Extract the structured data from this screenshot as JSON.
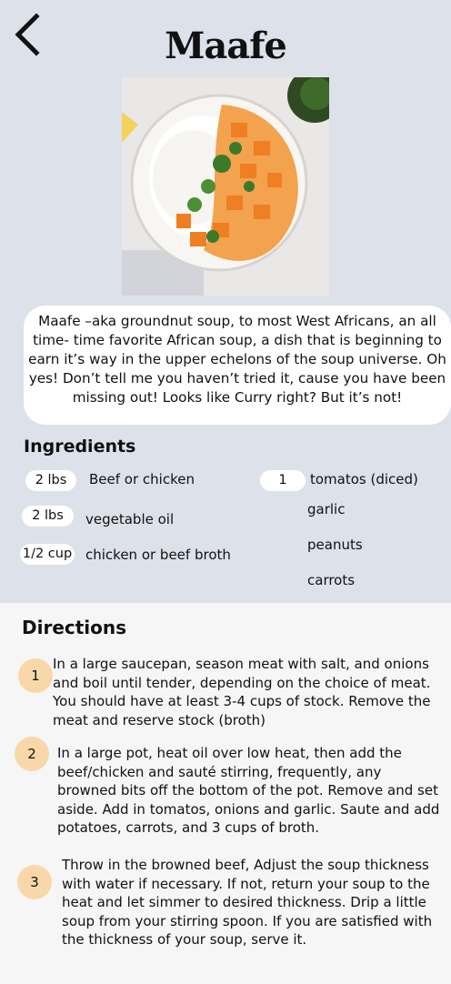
{
  "header": {
    "title": "Maafe"
  },
  "description": "Maafe –aka groundnut soup, to most West Africans, an all time- time favorite African soup, a dish that is beginning to earn it’s way in the upper echelons of the soup universe. Oh yes! Don’t tell me you haven’t tried it, cause you have been missing out! Looks like Curry right? But it’s not!",
  "ingredients": {
    "title": "Ingredients",
    "left": [
      {
        "qty": "2 lbs",
        "name": "Beef or chicken"
      },
      {
        "qty": "2 lbs",
        "name": "vegetable oil"
      },
      {
        "qty": "1/2 cup",
        "name": "chicken or beef broth"
      }
    ],
    "right": [
      {
        "qty": "1",
        "name": "tomatos (diced)"
      },
      {
        "name": "garlic"
      },
      {
        "name": "peanuts"
      },
      {
        "name": "carrots"
      }
    ]
  },
  "directions": {
    "title": "Directions",
    "steps": [
      {
        "num": "1",
        "text": "In a large saucepan, season meat with salt, and onions and boil until tender, depending on the choice of meat. You should have at least 3-4 cups of stock. Remove the meat and reserve stock (broth)"
      },
      {
        "num": "2",
        "text": "In a large pot, heat oil over low heat, then add the beef/chicken and sauté stirring, frequently, any browned bits off the bottom of the pot. Remove and set aside. Add in tomatos, onions and garlic. Saute and add potatoes, carrots, and 3 cups of broth."
      },
      {
        "num": "3",
        "text": "Throw in the browned beef, Adjust the soup thickness with water if necessary. If not, return your soup to the heat and let simmer to desired thickness. Drip a little soup from your stirring spoon. If you are satisfied with the thickness of your soup, serve it."
      }
    ]
  },
  "colors": {
    "top_background": "#dde1ea",
    "bottom_background": "#f6f6f6",
    "step_badge": "#f8d8a8",
    "pill": "#ffffff"
  },
  "icons": {
    "back": "chevron-left-icon"
  }
}
